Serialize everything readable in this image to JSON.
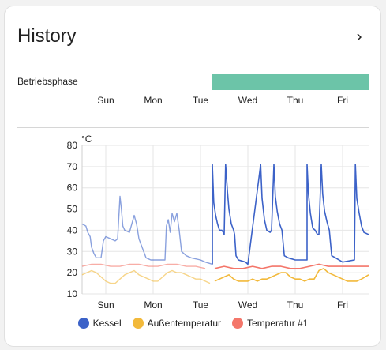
{
  "card": {
    "title": "History"
  },
  "timeline": {
    "label": "Betriebsphase",
    "color": "#6cc4a8",
    "x_labels": [
      "Sun",
      "Mon",
      "Tue",
      "Wed",
      "Thu",
      "Fri"
    ]
  },
  "chart_data": {
    "type": "line",
    "unit": "°C",
    "ylim": [
      10,
      80
    ],
    "yticks": [
      10,
      20,
      30,
      40,
      50,
      60,
      70,
      80
    ],
    "x_labels": [
      "Sun",
      "Mon",
      "Tue",
      "Wed",
      "Thu",
      "Fri"
    ],
    "x_day_range": [
      -0.5,
      5.55
    ],
    "grid": true,
    "legend_position": "bottom",
    "series": [
      {
        "name": "Kessel",
        "color": "#3c62c8",
        "faded_until_day": 2.25,
        "points": [
          [
            -0.5,
            43
          ],
          [
            -0.42,
            42
          ],
          [
            -0.38,
            39
          ],
          [
            -0.33,
            37
          ],
          [
            -0.3,
            32
          ],
          [
            -0.25,
            29
          ],
          [
            -0.2,
            27
          ],
          [
            -0.1,
            27
          ],
          [
            -0.05,
            35
          ],
          [
            0,
            37
          ],
          [
            0.1,
            36
          ],
          [
            0.2,
            35
          ],
          [
            0.25,
            36
          ],
          [
            0.3,
            56
          ],
          [
            0.33,
            50
          ],
          [
            0.36,
            42
          ],
          [
            0.4,
            40
          ],
          [
            0.5,
            39
          ],
          [
            0.6,
            47
          ],
          [
            0.65,
            43
          ],
          [
            0.7,
            36
          ],
          [
            0.8,
            30
          ],
          [
            0.85,
            27
          ],
          [
            0.95,
            26
          ],
          [
            1.1,
            26
          ],
          [
            1.25,
            26
          ],
          [
            1.28,
            42
          ],
          [
            1.32,
            45
          ],
          [
            1.36,
            39
          ],
          [
            1.4,
            48
          ],
          [
            1.45,
            44
          ],
          [
            1.5,
            48
          ],
          [
            1.55,
            40
          ],
          [
            1.6,
            30
          ],
          [
            1.7,
            28
          ],
          [
            1.8,
            27
          ],
          [
            2.0,
            26
          ],
          [
            2.1,
            25
          ],
          [
            2.25,
            24
          ],
          [
            2.25,
            71
          ],
          [
            2.28,
            53
          ],
          [
            2.32,
            47
          ],
          [
            2.36,
            43
          ],
          [
            2.4,
            40
          ],
          [
            2.45,
            40
          ],
          [
            2.48,
            39
          ],
          [
            2.5,
            38
          ],
          [
            2.53,
            71
          ],
          [
            2.57,
            58
          ],
          [
            2.6,
            50
          ],
          [
            2.65,
            43
          ],
          [
            2.7,
            40
          ],
          [
            2.72,
            38
          ],
          [
            2.75,
            28
          ],
          [
            2.8,
            26
          ],
          [
            2.95,
            25
          ],
          [
            3.0,
            24
          ],
          [
            3.27,
            71
          ],
          [
            3.3,
            55
          ],
          [
            3.35,
            45
          ],
          [
            3.4,
            40
          ],
          [
            3.47,
            39
          ],
          [
            3.5,
            40
          ],
          [
            3.55,
            71
          ],
          [
            3.58,
            56
          ],
          [
            3.62,
            49
          ],
          [
            3.67,
            43
          ],
          [
            3.72,
            40
          ],
          [
            3.77,
            28
          ],
          [
            3.85,
            27
          ],
          [
            4.0,
            26
          ],
          [
            4.25,
            26
          ],
          [
            4.25,
            71
          ],
          [
            4.28,
            57
          ],
          [
            4.32,
            48
          ],
          [
            4.37,
            41
          ],
          [
            4.42,
            40
          ],
          [
            4.47,
            38
          ],
          [
            4.5,
            38
          ],
          [
            4.55,
            71
          ],
          [
            4.58,
            57
          ],
          [
            4.62,
            49
          ],
          [
            4.67,
            44
          ],
          [
            4.72,
            40
          ],
          [
            4.77,
            28
          ],
          [
            4.85,
            27
          ],
          [
            5.0,
            25
          ],
          [
            5.25,
            26
          ],
          [
            5.27,
            71
          ],
          [
            5.3,
            55
          ],
          [
            5.35,
            48
          ],
          [
            5.4,
            42
          ],
          [
            5.45,
            39
          ],
          [
            5.55,
            38
          ]
        ]
      },
      {
        "name": "Außentemperatur",
        "color": "#f2b93b",
        "faded_until_day": 2.25,
        "points": [
          [
            -0.5,
            19
          ],
          [
            -0.4,
            20
          ],
          [
            -0.3,
            21
          ],
          [
            -0.2,
            20
          ],
          [
            -0.1,
            18
          ],
          [
            0,
            16
          ],
          [
            0.1,
            15
          ],
          [
            0.2,
            15
          ],
          [
            0.3,
            17
          ],
          [
            0.4,
            19
          ],
          [
            0.5,
            20
          ],
          [
            0.6,
            21
          ],
          [
            0.7,
            19
          ],
          [
            0.8,
            18
          ],
          [
            0.9,
            17
          ],
          [
            1.0,
            16
          ],
          [
            1.1,
            16
          ],
          [
            1.2,
            18
          ],
          [
            1.3,
            20
          ],
          [
            1.4,
            21
          ],
          [
            1.5,
            20
          ],
          [
            1.6,
            20
          ],
          [
            1.7,
            19
          ],
          [
            1.8,
            18
          ],
          [
            1.9,
            17
          ],
          [
            2.0,
            17
          ],
          [
            2.1,
            16
          ],
          [
            2.2,
            15
          ],
          [
            2.3,
            16
          ],
          [
            2.4,
            17
          ],
          [
            2.5,
            18
          ],
          [
            2.6,
            19
          ],
          [
            2.7,
            17
          ],
          [
            2.8,
            16
          ],
          [
            2.9,
            16
          ],
          [
            3.0,
            16
          ],
          [
            3.1,
            17
          ],
          [
            3.2,
            16
          ],
          [
            3.3,
            17
          ],
          [
            3.4,
            17
          ],
          [
            3.5,
            18
          ],
          [
            3.6,
            19
          ],
          [
            3.7,
            20
          ],
          [
            3.8,
            20
          ],
          [
            3.9,
            18
          ],
          [
            4.0,
            17
          ],
          [
            4.1,
            17
          ],
          [
            4.2,
            16
          ],
          [
            4.3,
            17
          ],
          [
            4.4,
            17
          ],
          [
            4.5,
            21
          ],
          [
            4.6,
            22
          ],
          [
            4.7,
            20
          ],
          [
            4.8,
            19
          ],
          [
            4.9,
            18
          ],
          [
            5.0,
            17
          ],
          [
            5.1,
            16
          ],
          [
            5.2,
            16
          ],
          [
            5.3,
            16
          ],
          [
            5.4,
            17
          ],
          [
            5.55,
            19
          ]
        ]
      },
      {
        "name": "Temperatur #1",
        "color": "#f4766a",
        "faded_until_day": 2.25,
        "points": [
          [
            -0.5,
            23
          ],
          [
            -0.3,
            24
          ],
          [
            -0.1,
            24
          ],
          [
            0.1,
            23
          ],
          [
            0.3,
            23
          ],
          [
            0.5,
            24
          ],
          [
            0.7,
            24
          ],
          [
            0.9,
            23
          ],
          [
            1.1,
            23
          ],
          [
            1.3,
            24
          ],
          [
            1.5,
            24
          ],
          [
            1.7,
            23
          ],
          [
            1.9,
            23
          ],
          [
            2.1,
            22
          ],
          [
            2.3,
            22
          ],
          [
            2.5,
            23
          ],
          [
            2.7,
            22
          ],
          [
            2.9,
            22
          ],
          [
            3.1,
            23
          ],
          [
            3.3,
            22
          ],
          [
            3.5,
            23
          ],
          [
            3.7,
            23
          ],
          [
            3.9,
            22
          ],
          [
            4.1,
            22
          ],
          [
            4.3,
            23
          ],
          [
            4.5,
            24
          ],
          [
            4.7,
            23
          ],
          [
            4.9,
            23
          ],
          [
            5.1,
            23
          ],
          [
            5.3,
            23
          ],
          [
            5.55,
            23
          ]
        ]
      }
    ]
  }
}
